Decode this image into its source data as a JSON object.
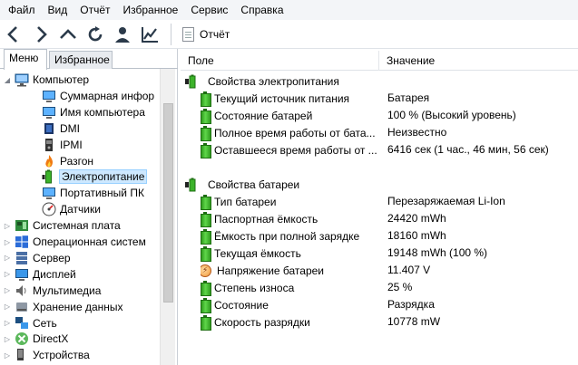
{
  "menu": [
    "Файл",
    "Вид",
    "Отчёт",
    "Избранное",
    "Сервис",
    "Справка"
  ],
  "toolbar": {
    "report_label": "Отчёт"
  },
  "left_tabs": {
    "menu": "Меню",
    "favorites": "Избранное"
  },
  "tree": [
    {
      "label": "Компьютер",
      "icon": "computer-icon",
      "expander": "open"
    },
    {
      "label": "Суммарная инфор",
      "icon": "monitor-icon"
    },
    {
      "label": "Имя компьютера",
      "icon": "monitor-icon"
    },
    {
      "label": "DMI",
      "icon": "chip-icon"
    },
    {
      "label": "IPMI",
      "icon": "device-icon"
    },
    {
      "label": "Разгон",
      "icon": "flame-icon"
    },
    {
      "label": "Электропитание",
      "icon": "battery-plug-icon",
      "selected": true
    },
    {
      "label": "Портативный ПК",
      "icon": "monitor-icon"
    },
    {
      "label": "Датчики",
      "icon": "gauge-icon"
    },
    {
      "label": "Системная плата",
      "icon": "motherboard-icon",
      "expander": "closed"
    },
    {
      "label": "Операционная систем",
      "icon": "windows-icon",
      "expander": "closed"
    },
    {
      "label": "Сервер",
      "icon": "server-icon",
      "expander": "closed"
    },
    {
      "label": "Дисплей",
      "icon": "display-icon",
      "expander": "closed"
    },
    {
      "label": "Мультимедиа",
      "icon": "speaker-icon",
      "expander": "closed"
    },
    {
      "label": "Хранение данных",
      "icon": "storage-icon",
      "expander": "closed"
    },
    {
      "label": "Сеть",
      "icon": "network-icon",
      "expander": "closed"
    },
    {
      "label": "DirectX",
      "icon": "directx-icon",
      "expander": "closed"
    },
    {
      "label": "Устройства",
      "icon": "devices-icon",
      "expander": "closed"
    }
  ],
  "columns": {
    "field": "Поле",
    "value": "Значение"
  },
  "groups": [
    {
      "title": "Свойства электропитания",
      "rows": [
        {
          "field": "Текущий источник питания",
          "value": "Батарея",
          "icon": "battery-icon"
        },
        {
          "field": "Состояние батарей",
          "value": "100 % (Высокий уровень)",
          "icon": "battery-icon"
        },
        {
          "field": "Полное время работы от бата...",
          "value": "Неизвестно",
          "icon": "battery-icon"
        },
        {
          "field": "Оставшееся время работы от ...",
          "value": "6416 сек (1 час., 46 мин, 56 сек)",
          "icon": "battery-icon"
        }
      ]
    },
    {
      "title": "Свойства батареи",
      "rows": [
        {
          "field": "Тип батареи",
          "value": "Перезаряжаемая Li-Ion",
          "icon": "battery-icon"
        },
        {
          "field": "Паспортная ёмкость",
          "value": "24420 mWh",
          "icon": "battery-icon"
        },
        {
          "field": "Ёмкость при полной зарядке",
          "value": "18160 mWh",
          "icon": "battery-icon"
        },
        {
          "field": "Текущая ёмкость",
          "value": "19148 mWh  (100 %)",
          "icon": "battery-icon"
        },
        {
          "field": "Напряжение батареи",
          "value": "11.407 V",
          "icon": "voltage-icon"
        },
        {
          "field": "Степень износа",
          "value": "25 %",
          "icon": "battery-icon"
        },
        {
          "field": "Состояние",
          "value": "Разрядка",
          "icon": "battery-icon"
        },
        {
          "field": "Скорость разрядки",
          "value": "10778 mW",
          "icon": "battery-icon"
        }
      ]
    }
  ],
  "colors": {
    "selection": "#cde8ff",
    "battery": "#3cb32a"
  }
}
